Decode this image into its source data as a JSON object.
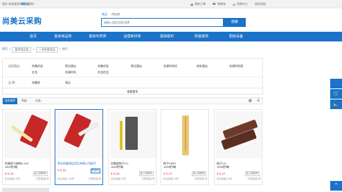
{
  "topbar": {
    "welcome": "您好 欢迎来到尚美云采购！",
    "login": "请登录",
    "links": [
      "我的订单",
      "购物车",
      "采购中心",
      "网站导航"
    ]
  },
  "header": {
    "logo": "尚美云采购",
    "search_tabs": [
      "商品",
      "供应商"
    ],
    "search_placeholder": "请输入商品名称/品牌",
    "search_button": "搜索"
  },
  "nav": {
    "items": [
      "首页",
      "客房用品类",
      "客房布草类",
      "运营耗材类",
      "基础建材",
      "软装装饰",
      "厨房设备"
    ]
  },
  "breadcrumb": {
    "home": "首页",
    "items": [
      "客房用品类",
      "一次性客用品",
      "梳子"
    ]
  },
  "filter": {
    "brand_label": "适用酒店：",
    "brands_row1": [
      "尚美优选",
      "智泊酒店",
      "尚美优选",
      "智泊酒店",
      "花漾时尚优",
      "商务酒店",
      "花漾时尚酒"
    ],
    "brands_row2": [
      "艺龙",
      "花漾时尚",
      "艺龙优品"
    ],
    "category_label": "品 牌：",
    "categories": [
      "尚美舒",
      "高足"
    ],
    "more": "查看更多"
  },
  "sort": {
    "items": [
      "综合排序",
      "销量↓",
      "价格↓"
    ]
  },
  "products": [
    {
      "name": "尚美舒卡扁梳/L140",
      "unit": "1600把/箱",
      "price": "¥ 0.23",
      "cart": "加入购物车",
      "left": "综合销量 26件",
      "right": "已售数量0件"
    },
    {
      "name": "青岛尚美酒店用品有限公司梳子",
      "unit": "",
      "price": "¥ 0.15",
      "cart": "购物车",
      "left": "综合销量 100件",
      "right": "已售数量0件"
    },
    {
      "name": "尚美舒梳子/JY",
      "unit": "1600把/箱",
      "price": "¥ 0.23",
      "cart": "加入购物车",
      "left": "综合销量 25件",
      "right": "已售数量0件"
    },
    {
      "name": "梳子/HMS",
      "unit": "1000把/箱",
      "price": "¥ 0.47",
      "cart": "加入购物车",
      "left": "综合销量 16件",
      "right": "已售数量0件"
    },
    {
      "name": "梳子/JX",
      "unit": "1000把/箱",
      "price": "¥ 0.47",
      "cart": "加入购物车",
      "left": "综合销量 20件",
      "right": "已售数量0件"
    }
  ]
}
